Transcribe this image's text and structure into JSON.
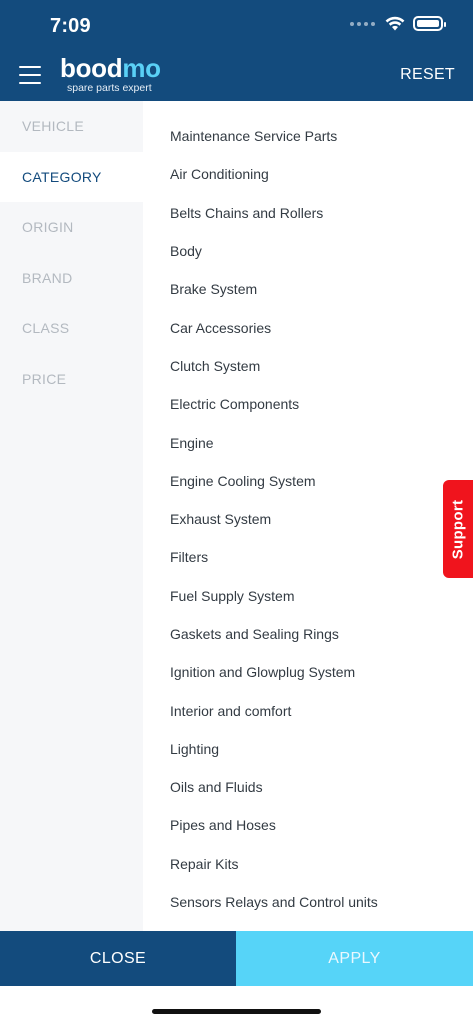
{
  "status_bar": {
    "time": "7:09"
  },
  "header": {
    "logo_part1": "bood",
    "logo_part2": "mo",
    "logo_tagline": "spare parts expert",
    "reset_label": "RESET"
  },
  "sidebar": {
    "items": [
      {
        "label": "VEHICLE",
        "active": false
      },
      {
        "label": "CATEGORY",
        "active": true
      },
      {
        "label": "ORIGIN",
        "active": false
      },
      {
        "label": "BRAND",
        "active": false
      },
      {
        "label": "CLASS",
        "active": false
      },
      {
        "label": "PRICE",
        "active": false
      }
    ]
  },
  "categories": [
    "Maintenance Service Parts",
    "Air Conditioning",
    "Belts Chains and Rollers",
    "Body",
    "Brake System",
    "Car Accessories",
    "Clutch System",
    "Electric Components",
    "Engine",
    "Engine Cooling System",
    "Exhaust System",
    "Filters",
    "Fuel Supply System",
    "Gaskets and Sealing Rings",
    "Ignition and Glowplug System",
    "Interior and comfort",
    "Lighting",
    "Oils and Fluids",
    "Pipes and Hoses",
    "Repair Kits",
    "Sensors Relays and Control units"
  ],
  "support_label": "Support",
  "footer": {
    "close_label": "CLOSE",
    "apply_label": "APPLY"
  },
  "colors": {
    "brand_primary": "#134b7d",
    "brand_accent": "#5ad0f6",
    "apply_button": "#56d4f8",
    "support_tab": "#f0141d"
  },
  "icons": {
    "menu": "hamburger-icon",
    "wifi": "wifi-icon",
    "battery": "battery-icon",
    "signal": "signal-dots-icon"
  }
}
